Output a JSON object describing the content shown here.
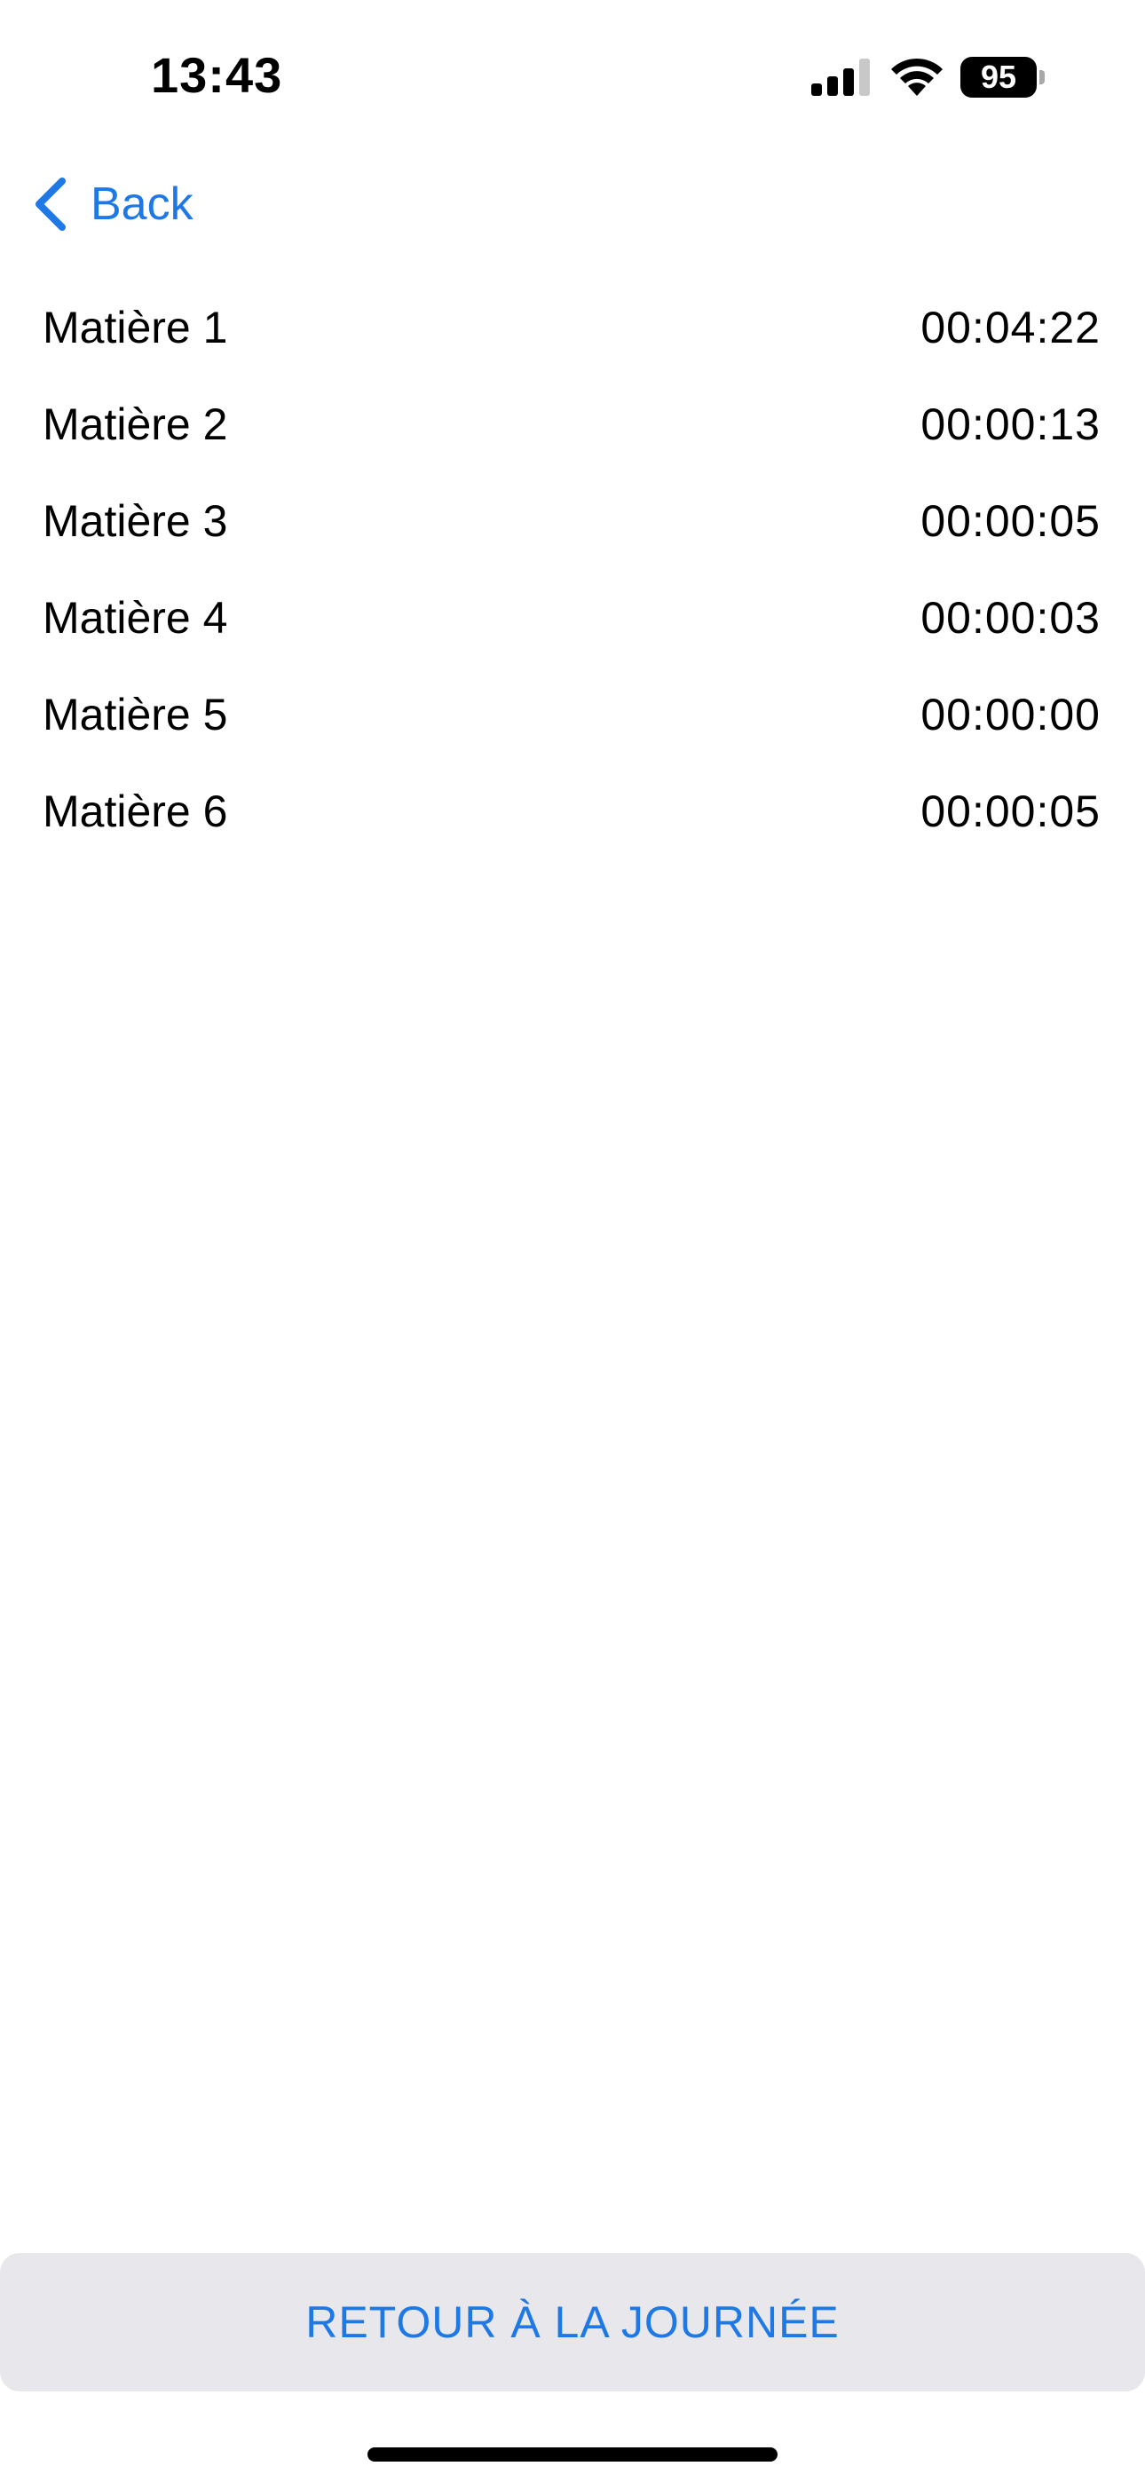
{
  "status_bar": {
    "time": "13:43",
    "battery_level": "95",
    "icons": [
      "signal-icon",
      "wifi-icon",
      "battery-icon"
    ]
  },
  "nav": {
    "back_label": "Back",
    "back_icon": "chevron-left-icon"
  },
  "rows": [
    {
      "label": "Matière 1",
      "value": "00:04:22"
    },
    {
      "label": "Matière 2",
      "value": "00:00:13"
    },
    {
      "label": "Matière 3",
      "value": "00:00:05"
    },
    {
      "label": "Matière 4",
      "value": "00:00:03"
    },
    {
      "label": "Matière 5",
      "value": "00:00:00"
    },
    {
      "label": "Matière 6",
      "value": "00:00:05"
    }
  ],
  "footer": {
    "button_label": "RETOUR À LA JOURNÉE"
  },
  "colors": {
    "accent": "#1e78e6",
    "button_background": "#e8e8ec"
  }
}
